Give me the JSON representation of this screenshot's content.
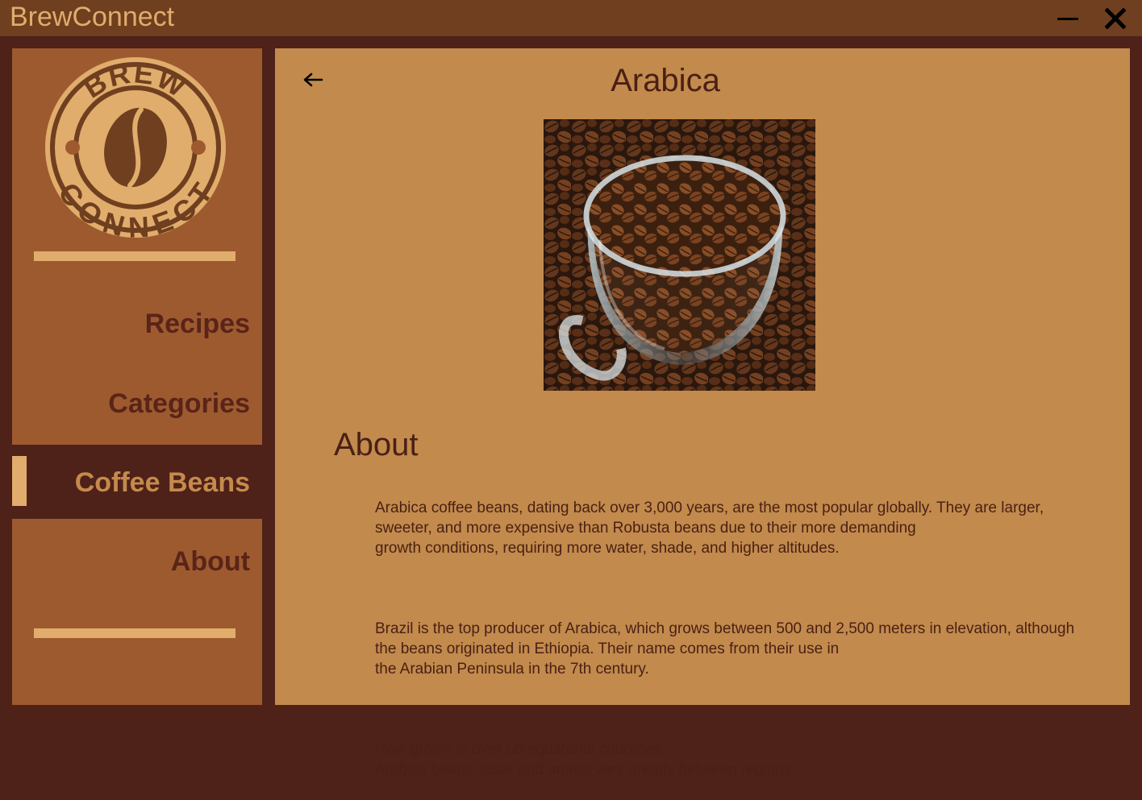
{
  "window": {
    "title": "BrewConnect",
    "minimize_icon": "minimize-icon",
    "close_icon": "close-icon"
  },
  "sidebar": {
    "logo": {
      "top_text": "BREW",
      "bottom_text": "CONNECT"
    },
    "items": [
      {
        "label": "Recipes",
        "active": false
      },
      {
        "label": "Categories",
        "active": false
      },
      {
        "label": "Coffee Beans",
        "active": true
      },
      {
        "label": "About",
        "active": false
      }
    ]
  },
  "main": {
    "back_icon": "arrow-left-icon",
    "title": "Arabica",
    "image": "coffee-beans-in-glass-cup",
    "section_title": "About",
    "paragraphs": [
      "Arabica coffee beans, dating back over 3,000 years, are the most popular globally. They are larger,\n sweeter, and more expensive than Robusta beans due to their more demanding\ngrowth conditions, requiring more water, shade, and higher altitudes.",
      "Brazil is the top producer of Arabica, which grows between 500 and 2,500 meters in elevation, although\nthe beans originated in Ethiopia. Their name comes from their use in\nthe Arabian Peninsula in the 7th century.",
      "Now grown in over 50 equatorial countries,\nArabica beans' taste and aroma vary greatly between regions."
    ]
  },
  "colors": {
    "titlebar": "#6f3f1f",
    "frame": "#4e2119",
    "sidebar": "#9e5a2f",
    "content": "#c28a4c",
    "accent": "#e0ad6c",
    "text_dark": "#5a2418"
  }
}
